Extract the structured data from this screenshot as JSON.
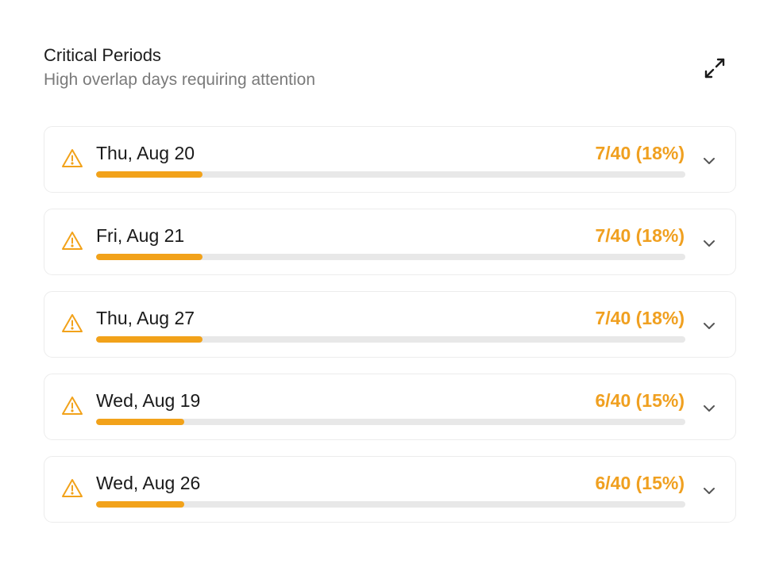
{
  "header": {
    "title": "Critical Periods",
    "subtitle": "High overlap days requiring attention"
  },
  "icons": {
    "expand": "expand-arrows-icon",
    "warning": "warning-triangle-icon",
    "chevron": "chevron-down-icon"
  },
  "colors": {
    "accent": "#f2a21a",
    "track": "#e8e8e8"
  },
  "periods": [
    {
      "day": "Thu, Aug 20",
      "count": "7/40 (18%)",
      "fraction": 0.18
    },
    {
      "day": "Fri, Aug 21",
      "count": "7/40 (18%)",
      "fraction": 0.18
    },
    {
      "day": "Thu, Aug 27",
      "count": "7/40 (18%)",
      "fraction": 0.18
    },
    {
      "day": "Wed, Aug 19",
      "count": "6/40 (15%)",
      "fraction": 0.15
    },
    {
      "day": "Wed, Aug 26",
      "count": "6/40 (15%)",
      "fraction": 0.15
    }
  ]
}
